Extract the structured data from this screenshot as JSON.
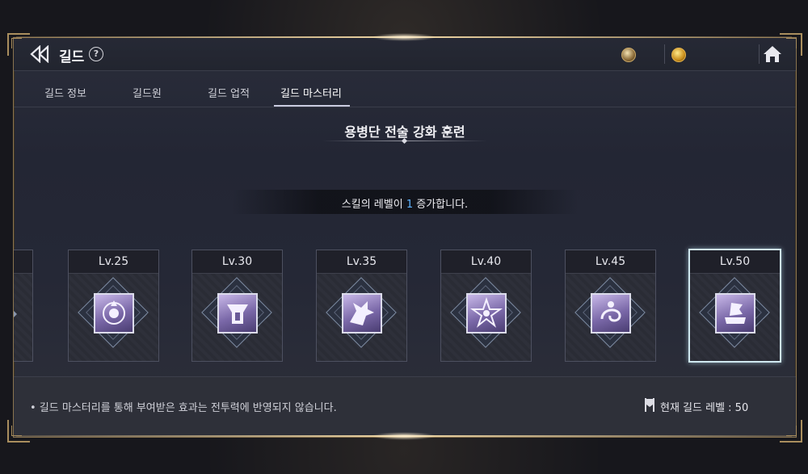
{
  "header": {
    "title": "길드",
    "help_symbol": "?"
  },
  "tabs": [
    {
      "label": "길드 정보",
      "active": false
    },
    {
      "label": "길드원",
      "active": false
    },
    {
      "label": "길드 업적",
      "active": false
    },
    {
      "label": "길드 마스터리",
      "active": true
    }
  ],
  "main": {
    "section_title": "용병단 전술 강화 훈련",
    "description_prefix": "스킬의 레벨이 ",
    "description_highlight": "1",
    "description_suffix": " 증가합니다.",
    "cards": [
      {
        "level": "Lv.25",
        "icon": "shield-crest-icon",
        "selected": false
      },
      {
        "level": "Lv.30",
        "icon": "helmet-icon",
        "selected": false
      },
      {
        "level": "Lv.35",
        "icon": "dragon-icon",
        "selected": false
      },
      {
        "level": "Lv.40",
        "icon": "star-emblem-icon",
        "selected": false
      },
      {
        "level": "Lv.45",
        "icon": "serpent-icon",
        "selected": false
      },
      {
        "level": "Lv.50",
        "icon": "banner-icon",
        "selected": true
      }
    ]
  },
  "footer": {
    "note": "• 길드 마스터리를 통해 부여받은 효과는 전투력에 반영되지 않습니다.",
    "guild_level_label": "현재 길드 레벨 : 50"
  },
  "colors": {
    "accent_gold": "#a98e5e",
    "highlight_blue": "#5fb4ff",
    "selected_border": "#cfe8f0"
  }
}
